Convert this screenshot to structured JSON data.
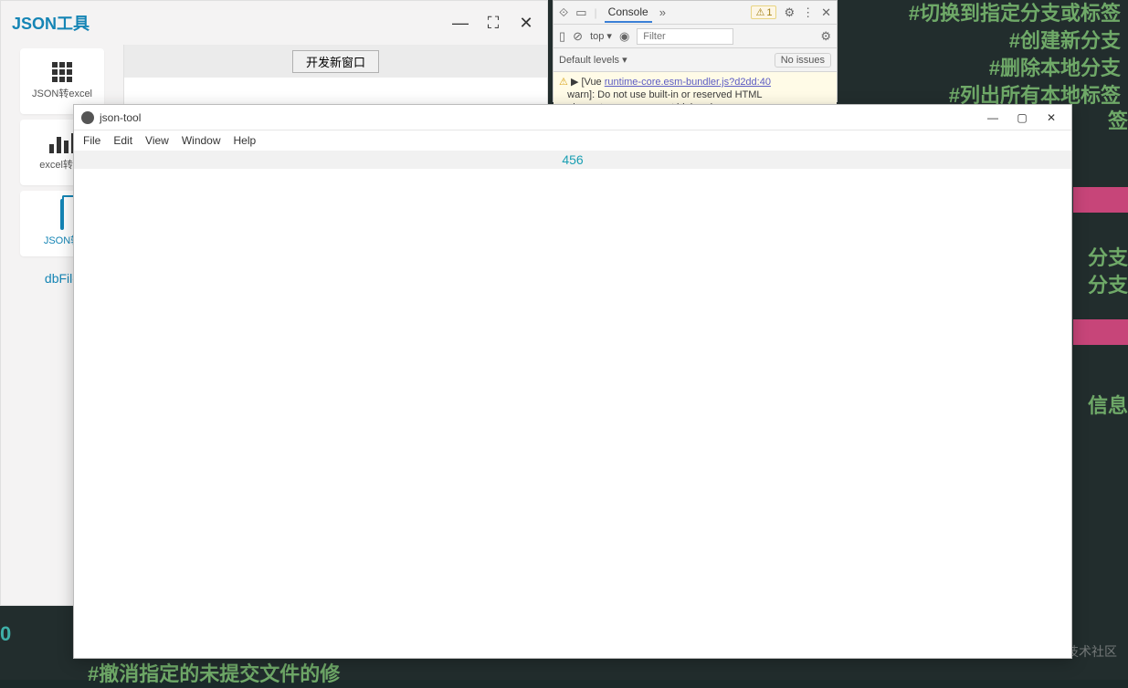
{
  "background": {
    "lines": [
      "#切换到指定分支或标签",
      "#创建新分支",
      "#删除本地分支",
      "#列出所有本地标签"
    ],
    "partial_right": [
      "签",
      "分支",
      "分支",
      "信息"
    ],
    "bottom_partial": "#撤消指定的未提交文件的修",
    "left_num": "0",
    "watermark": "@稀土掘金技术社区"
  },
  "json_window": {
    "title": "JSON工具",
    "controls": {
      "min": "—",
      "max": "⛶",
      "close": "✕"
    },
    "tiles": [
      {
        "label": "JSON转excel",
        "icon": "grid"
      },
      {
        "label": "excel转JS",
        "icon": "bars"
      },
      {
        "label": "JSON转",
        "icon": "folder"
      }
    ],
    "link": "dbFile",
    "button": "开发新窗口"
  },
  "devtools": {
    "tab": "Console",
    "expand": "»",
    "warn_count": "1",
    "top_label": "top ▾",
    "filter_placeholder": "Filter",
    "levels_label": "Default levels ▾",
    "no_issues": "No issues",
    "log_prefix": "▶ [Vue",
    "log_link": "runtime-core.esm-bundler.js?d2dd:40",
    "log_line2": "warn]: Do not use built-in or reserved HTML",
    "log_line3": "elements as component id: header"
  },
  "jt": {
    "title": "json-tool",
    "menu": [
      "File",
      "Edit",
      "View",
      "Window",
      "Help"
    ],
    "controls": {
      "min": "—",
      "max": "▢",
      "close": "✕"
    },
    "content_value": "456"
  }
}
